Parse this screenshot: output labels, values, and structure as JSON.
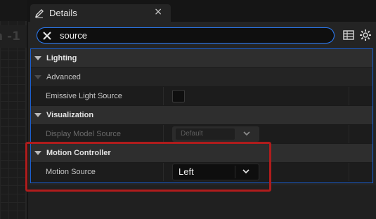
{
  "viewport": {
    "header_text": "n -1"
  },
  "tab": {
    "label": "Details",
    "close_glyph": "×",
    "icon": "pencil-icon"
  },
  "search": {
    "value": "source",
    "clear_icon": "x-icon"
  },
  "toolbar": {
    "icons": [
      "table-view-icon",
      "gear-icon"
    ]
  },
  "categories": {
    "lighting": {
      "label": "Lighting"
    },
    "advanced": {
      "label": "Advanced"
    },
    "visualization": {
      "label": "Visualization"
    },
    "motion_controller": {
      "label": "Motion Controller"
    }
  },
  "properties": {
    "emissive_light_source": {
      "label": "Emissive Light Source",
      "checked": false
    },
    "display_model_source": {
      "label": "Display Model Source",
      "value": "Default",
      "enabled": false
    },
    "motion_source": {
      "label": "Motion Source",
      "value": "Left",
      "enabled": true
    }
  },
  "colors": {
    "accent_blue": "#2b7fff",
    "highlight_red": "#b01c1c",
    "panel_bg": "#242424"
  }
}
